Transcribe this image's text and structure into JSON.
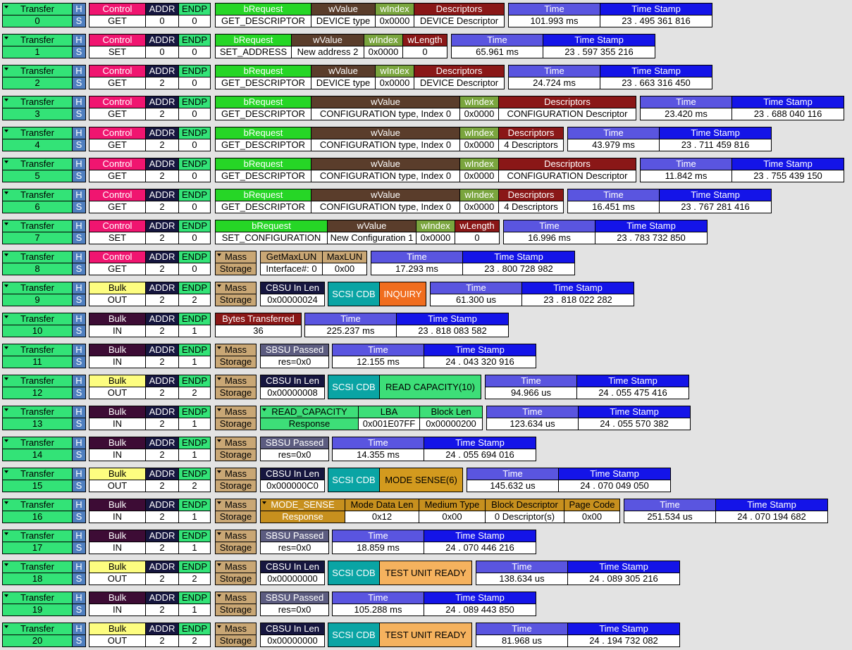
{
  "labels": {
    "transfer": "Transfer",
    "h": "H",
    "s": "S",
    "control": "Control",
    "bulk": "Bulk",
    "addr": "ADDR",
    "endp": "ENDP",
    "mass": "Mass",
    "storage": "Storage",
    "brequest": "bRequest",
    "wvalue": "wValue",
    "windex": "wIndex",
    "wlength": "wLength",
    "descriptors": "Descriptors",
    "time": "Time",
    "timestamp": "Time Stamp",
    "getmaxlun": "GetMaxLUN",
    "maxlun": "MaxLUN",
    "cbsu_in_len": "CBSU In Len",
    "scsi_cdb": "SCSI CDB",
    "bytes_transferred": "Bytes Transferred",
    "sbsu_passed": "SBSU Passed",
    "read_capacity": "READ_CAPACITY",
    "response": "Response",
    "lba": "LBA",
    "block_len": "Block Len",
    "mode_sense": "MODE_SENSE",
    "mode_data_len": "Mode Data Len",
    "medium_type": "Medium Type",
    "block_descriptor": "Block Descriptor",
    "page_code": "Page Code"
  },
  "colors": {
    "transfer": "#33e377",
    "control": "#f01570",
    "bulk_out": "#fdfd80",
    "bulk_in": "#3d0c35",
    "addr": "#16163f",
    "endp": "#33e377",
    "brequest": "#26d626",
    "wvalue": "#5a3d2b",
    "windex": "#7aa53e",
    "descriptors": "#8a1717",
    "time": "#5a55e0",
    "timestamp": "#1414e8",
    "mass": "#c9a775",
    "getmaxlun": "#c9a775",
    "cbsu": "#16163f",
    "scsi_cdb": "#0aa4a4",
    "inquiry": "#f06d1e",
    "read_capacity_10": "#3dde78",
    "mode_sense_6": "#d39a1e",
    "test_unit_ready": "#f5b25e",
    "bytes_transferred": "#8a1717",
    "sbsu": "#5c5c80",
    "read_capacity_resp": "#3dde78",
    "mode_sense_resp": "#c7901e"
  },
  "transfers": [
    {
      "num": "0",
      "kind": "GET",
      "addr": "0",
      "endp": "0",
      "brequest": "GET_DESCRIPTOR",
      "wvalue": "DEVICE type",
      "windex": "0x0000",
      "descriptor": "DEVICE Descriptor",
      "time": "101.993 ms",
      "timestamp": "23 . 495 361 816"
    },
    {
      "num": "1",
      "kind": "SET",
      "addr": "0",
      "endp": "0",
      "brequest": "SET_ADDRESS",
      "wvalue": "New address 2",
      "windex": "0x0000",
      "wlength": "0",
      "time": "65.961 ms",
      "timestamp": "23 . 597 355 216"
    },
    {
      "num": "2",
      "kind": "GET",
      "addr": "2",
      "endp": "0",
      "brequest": "GET_DESCRIPTOR",
      "wvalue": "DEVICE type",
      "windex": "0x0000",
      "descriptor": "DEVICE Descriptor",
      "time": "24.724 ms",
      "timestamp": "23 . 663 316 450"
    },
    {
      "num": "3",
      "kind": "GET",
      "addr": "2",
      "endp": "0",
      "brequest": "GET_DESCRIPTOR",
      "wvalue": "CONFIGURATION type, Index 0",
      "windex": "0x0000",
      "descriptor": "CONFIGURATION Descriptor",
      "time": "23.420 ms",
      "timestamp": "23 . 688 040 116"
    },
    {
      "num": "4",
      "kind": "GET",
      "addr": "2",
      "endp": "0",
      "brequest": "GET_DESCRIPTOR",
      "wvalue": "CONFIGURATION type, Index 0",
      "windex": "0x0000",
      "descriptor": "4 Descriptors",
      "time": "43.979 ms",
      "timestamp": "23 . 711 459 816"
    },
    {
      "num": "5",
      "kind": "GET",
      "addr": "2",
      "endp": "0",
      "brequest": "GET_DESCRIPTOR",
      "wvalue": "CONFIGURATION type, Index 0",
      "windex": "0x0000",
      "descriptor": "CONFIGURATION Descriptor",
      "time": "11.842 ms",
      "timestamp": "23 . 755 439 150"
    },
    {
      "num": "6",
      "kind": "GET",
      "addr": "2",
      "endp": "0",
      "brequest": "GET_DESCRIPTOR",
      "wvalue": "CONFIGURATION type, Index 0",
      "windex": "0x0000",
      "descriptor": "4 Descriptors",
      "time": "16.451 ms",
      "timestamp": "23 . 767 281 416"
    },
    {
      "num": "7",
      "kind": "SET",
      "addr": "2",
      "endp": "0",
      "brequest": "SET_CONFIGURATION",
      "wvalue": "New Configuration 1",
      "windex": "0x0000",
      "wlength": "0",
      "time": "16.996 ms",
      "timestamp": "23 . 783 732 850"
    },
    {
      "num": "8",
      "kind": "GET",
      "addr": "2",
      "endp": "0",
      "interface": "Interface#: 0",
      "maxlun": "0x00",
      "time": "17.293 ms",
      "timestamp": "23 . 800 728 982"
    },
    {
      "num": "9",
      "kind": "OUT",
      "addr": "2",
      "endp": "2",
      "cbsu": "0x00000024",
      "scsi": "INQUIRY",
      "time": "61.300 us",
      "timestamp": "23 . 818 022 282"
    },
    {
      "num": "10",
      "kind": "IN",
      "addr": "2",
      "endp": "1",
      "bytes": "36",
      "time": "225.237 ms",
      "timestamp": "23 . 818 083 582"
    },
    {
      "num": "11",
      "kind": "IN",
      "addr": "2",
      "endp": "1",
      "sbsu": "res=0x0",
      "time": "12.155 ms",
      "timestamp": "24 . 043 320 916"
    },
    {
      "num": "12",
      "kind": "OUT",
      "addr": "2",
      "endp": "2",
      "cbsu": "0x00000008",
      "scsi": "READ CAPACITY(10)",
      "time": "94.966 us",
      "timestamp": "24 . 055 475 416"
    },
    {
      "num": "13",
      "kind": "IN",
      "addr": "2",
      "endp": "1",
      "lba": "0x001E07FF",
      "block_len": "0x00000200",
      "time": "123.634 us",
      "timestamp": "24 . 055 570 382"
    },
    {
      "num": "14",
      "kind": "IN",
      "addr": "2",
      "endp": "1",
      "sbsu": "res=0x0",
      "time": "14.355 ms",
      "timestamp": "24 . 055 694 016"
    },
    {
      "num": "15",
      "kind": "OUT",
      "addr": "2",
      "endp": "2",
      "cbsu": "0x000000C0",
      "scsi": "MODE SENSE(6)",
      "time": "145.632 us",
      "timestamp": "24 . 070 049 050"
    },
    {
      "num": "16",
      "kind": "IN",
      "addr": "2",
      "endp": "1",
      "mode_data_len": "0x12",
      "medium_type": "0x00",
      "block_descriptor": "0 Descriptor(s)",
      "page_code": "0x00",
      "time": "251.534 us",
      "timestamp": "24 . 070 194 682"
    },
    {
      "num": "17",
      "kind": "IN",
      "addr": "2",
      "endp": "1",
      "sbsu": "res=0x0",
      "time": "18.859 ms",
      "timestamp": "24 . 070 446 216"
    },
    {
      "num": "18",
      "kind": "OUT",
      "addr": "2",
      "endp": "2",
      "cbsu": "0x00000000",
      "scsi": "TEST UNIT READY",
      "time": "138.634 us",
      "timestamp": "24 . 089 305 216"
    },
    {
      "num": "19",
      "kind": "IN",
      "addr": "2",
      "endp": "1",
      "sbsu": "res=0x0",
      "time": "105.288 ms",
      "timestamp": "24 . 089 443 850"
    },
    {
      "num": "20",
      "kind": "OUT",
      "addr": "2",
      "endp": "2",
      "cbsu": "0x00000000",
      "scsi": "TEST UNIT READY",
      "time": "81.968 us",
      "timestamp": "24 . 194 732 082"
    }
  ]
}
